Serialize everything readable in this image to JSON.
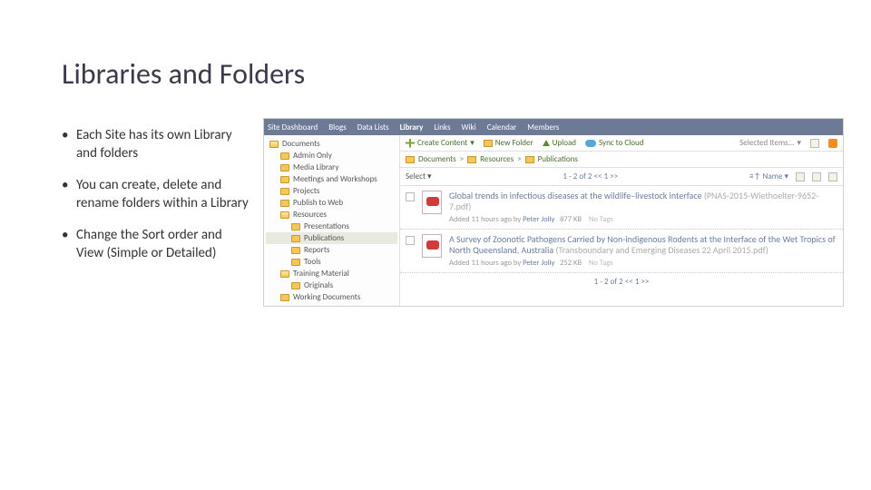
{
  "title": "Libraries and Folders",
  "bullets": [
    "Each Site has its own Library and folders",
    "You can create, delete and rename folders within a Library",
    "Change the Sort order and View (Simple or Detailed)"
  ],
  "nav": {
    "tabs": [
      "Site Dashboard",
      "Blogs",
      "Data Lists",
      "Library",
      "Links",
      "Wiki",
      "Calendar",
      "Members"
    ],
    "active": "Library"
  },
  "tree": [
    {
      "label": "Documents",
      "indent": 1,
      "open": true
    },
    {
      "label": "Admin Only",
      "indent": 2
    },
    {
      "label": "Media Library",
      "indent": 2
    },
    {
      "label": "Meetings and Workshops",
      "indent": 2
    },
    {
      "label": "Projects",
      "indent": 2
    },
    {
      "label": "Publish to Web",
      "indent": 2
    },
    {
      "label": "Resources",
      "indent": 2,
      "open": true
    },
    {
      "label": "Presentations",
      "indent": 3
    },
    {
      "label": "Publications",
      "indent": 3,
      "selected": true
    },
    {
      "label": "Reports",
      "indent": 3
    },
    {
      "label": "Tools",
      "indent": 3
    },
    {
      "label": "Training Material",
      "indent": 2,
      "open": true
    },
    {
      "label": "Originals",
      "indent": 3
    },
    {
      "label": "Working Documents",
      "indent": 2
    }
  ],
  "toolbar": {
    "create": "Create Content",
    "newFolder": "New Folder",
    "upload": "Upload",
    "sync": "Sync to Cloud",
    "selected": "Selected Items..."
  },
  "breadcrumbs": [
    "Documents",
    "Resources",
    "Publications"
  ],
  "listbar": {
    "select": "Select",
    "pager": "1 - 2 of 2   <<   1   >>",
    "sort": "Name"
  },
  "docs": [
    {
      "title": "Global trends in infectious diseases at the wildlife–livestock interface",
      "paren": "(PNAS-2015-Wiethoelter-9652-7.pdf)",
      "added": "Added 11 hours ago by",
      "user": "Peter Jolly",
      "size": "877 KB",
      "tags": "No Tags"
    },
    {
      "title": "A Survey of Zoonotic Pathogens Carried by Non-indigenous Rodents at the Interface of the Wet Tropics of North Queensland, Australia",
      "paren": "(Transboundary and Emerging Diseases 22 April 2015.pdf)",
      "added": "Added 11 hours ago by",
      "user": "Peter Jolly",
      "size": "252 KB",
      "tags": "No Tags"
    }
  ],
  "pager2": "1 - 2 of 2   <<   1   >>"
}
